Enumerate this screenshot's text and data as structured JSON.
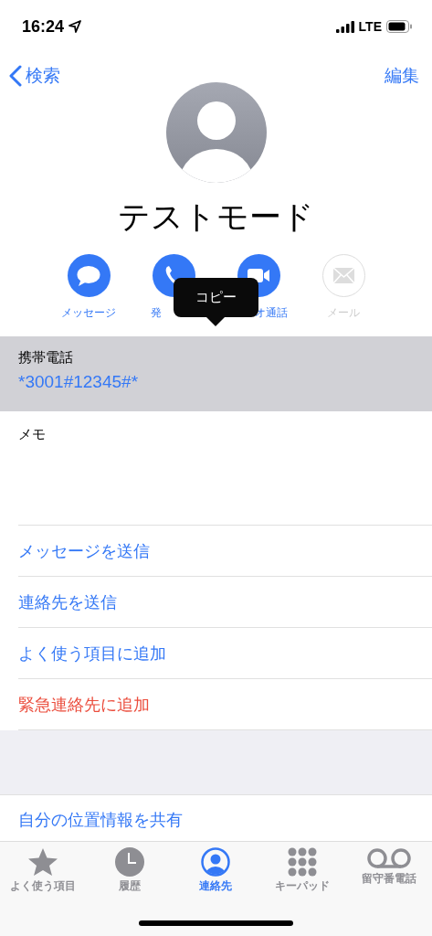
{
  "status_bar": {
    "time": "16:24",
    "network": "LTE"
  },
  "nav": {
    "back": "検索",
    "edit": "編集"
  },
  "contact": {
    "name": "テストモード"
  },
  "actions": [
    {
      "kind": "message",
      "label": "メッセージ",
      "disabled": false
    },
    {
      "kind": "call",
      "label": "発",
      "disabled": false
    },
    {
      "kind": "video",
      "label": "オ通話",
      "disabled": false
    },
    {
      "kind": "mail",
      "label": "メール",
      "disabled": true
    }
  ],
  "tooltip": {
    "text": "コピー"
  },
  "phone": {
    "label": "携帯電話",
    "value": "*3001#12345#*",
    "selected": true
  },
  "memo": {
    "label": "メモ"
  },
  "rows": [
    {
      "text": "メッセージを送信",
      "kind": "action"
    },
    {
      "text": "連絡先を送信",
      "kind": "action"
    },
    {
      "text": "よく使う項目に追加",
      "kind": "action"
    },
    {
      "text": "緊急連絡先に追加",
      "kind": "destructive"
    }
  ],
  "share_row": {
    "text": "自分の位置情報を共有"
  },
  "tabs": [
    {
      "kind": "favorites",
      "label": "よく使う項目",
      "selected": false
    },
    {
      "kind": "recents",
      "label": "履歴",
      "selected": false
    },
    {
      "kind": "contacts",
      "label": "連絡先",
      "selected": true
    },
    {
      "kind": "keypad",
      "label": "キーパッド",
      "selected": false
    },
    {
      "kind": "voicemail",
      "label": "留守番電話",
      "selected": false
    }
  ]
}
